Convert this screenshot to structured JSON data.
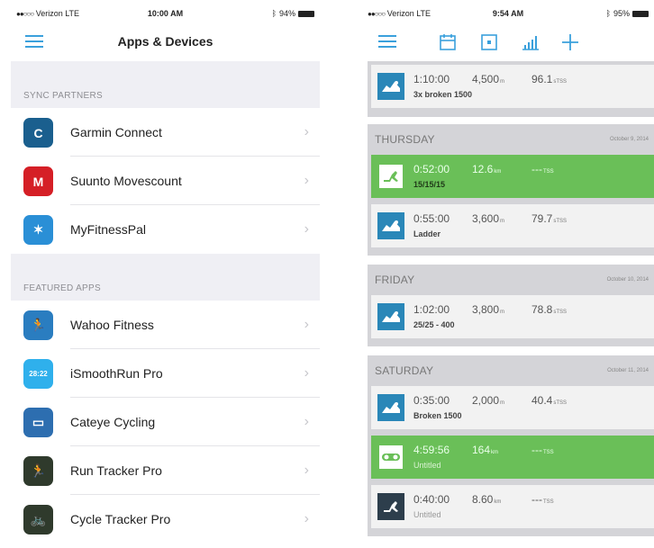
{
  "left": {
    "status": {
      "carrier": "Verizon  LTE",
      "time": "10:00 AM",
      "battery": "94%"
    },
    "title": "Apps & Devices",
    "sections": [
      {
        "label": "SYNC PARTNERS",
        "items": [
          {
            "name": "Garmin Connect",
            "icon": "garmin-connect-icon",
            "color": "#1a5f8e",
            "glyph": "C"
          },
          {
            "name": "Suunto Movescount",
            "icon": "suunto-movescount-icon",
            "color": "#d51f26",
            "glyph": "M"
          },
          {
            "name": "MyFitnessPal",
            "icon": "myfitnesspal-icon",
            "color": "#2a8fd6",
            "glyph": "✶"
          }
        ]
      },
      {
        "label": "FEATURED APPS",
        "items": [
          {
            "name": "Wahoo Fitness",
            "icon": "wahoo-fitness-icon",
            "color": "#2a7dc0",
            "glyph": "🏃"
          },
          {
            "name": "iSmoothRun Pro",
            "icon": "ismoothrun-icon",
            "color": "#2fb0ec",
            "glyph": "28:22"
          },
          {
            "name": "Cateye Cycling",
            "icon": "cateye-cycling-icon",
            "color": "#2d6eb0",
            "glyph": "▭"
          },
          {
            "name": "Run Tracker Pro",
            "icon": "run-tracker-icon",
            "color": "#2f3a2c",
            "glyph": "🏃"
          },
          {
            "name": "Cycle Tracker Pro",
            "icon": "cycle-tracker-icon",
            "color": "#2f3a2c",
            "glyph": "🚲"
          }
        ]
      }
    ]
  },
  "right": {
    "status": {
      "carrier": "Verizon  LTE",
      "time": "9:54 AM",
      "battery": "95%"
    },
    "toolbar": [
      "hamburger-menu-icon",
      "calendar-icon",
      "single-day-icon",
      "chart-icon",
      "add-icon"
    ],
    "top_card": {
      "time": "1:10:00",
      "dist": "4,500",
      "dist_unit": "m",
      "score": "96.1",
      "score_unit": "sTSS",
      "title": "3x broken 1500",
      "type": "swim"
    },
    "days": [
      {
        "name": "THURSDAY",
        "date": "October 9, 2014",
        "workouts": [
          {
            "time": "0:52:00",
            "dist": "12.6",
            "dist_unit": "km",
            "score": "---",
            "score_unit": "TSS",
            "title": "15/15/15",
            "type": "run",
            "green": true
          },
          {
            "time": "0:55:00",
            "dist": "3,600",
            "dist_unit": "m",
            "score": "79.7",
            "score_unit": "sTSS",
            "title": "Ladder",
            "type": "swim",
            "green": false
          }
        ]
      },
      {
        "name": "FRIDAY",
        "date": "October 10, 2014",
        "workouts": [
          {
            "time": "1:02:00",
            "dist": "3,800",
            "dist_unit": "m",
            "score": "78.8",
            "score_unit": "sTSS",
            "title": "25/25 - 400",
            "type": "swim",
            "green": false
          }
        ]
      },
      {
        "name": "SATURDAY",
        "date": "October 11, 2014",
        "workouts": [
          {
            "time": "0:35:00",
            "dist": "2,000",
            "dist_unit": "m",
            "score": "40.4",
            "score_unit": "sTSS",
            "title": "Broken 1500",
            "type": "swim",
            "green": false
          },
          {
            "time": "4:59:56",
            "dist": "164",
            "dist_unit": "km",
            "score": "---",
            "score_unit": "TSS",
            "title": "Untitled",
            "type": "bike",
            "green": true,
            "muted": true
          },
          {
            "time": "0:40:00",
            "dist": "8.60",
            "dist_unit": "km",
            "score": "---",
            "score_unit": "TSS",
            "title": "Untitled",
            "type": "run",
            "green": false,
            "muted": true,
            "dark": true
          }
        ]
      }
    ]
  }
}
